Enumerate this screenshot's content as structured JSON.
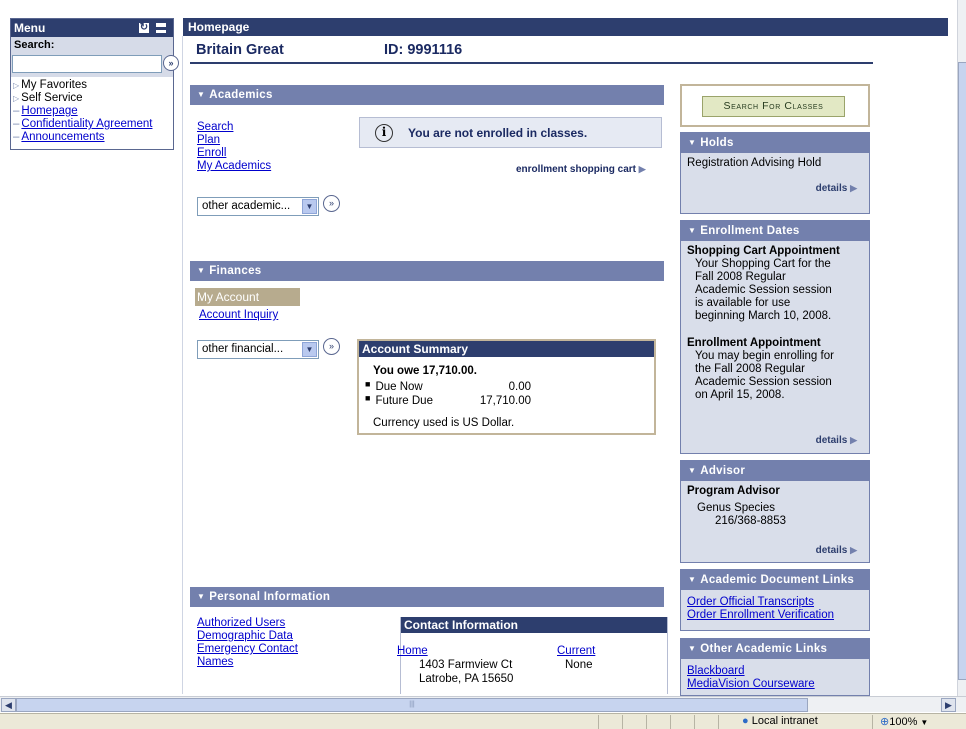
{
  "menu": {
    "title": "Menu",
    "search_label": "Search:",
    "search_value": "",
    "items": [
      {
        "label": "My Favorites"
      },
      {
        "label": "Self Service"
      },
      {
        "label": "Homepage"
      },
      {
        "label": "Confidentiality Agreement"
      },
      {
        "label": "Announcements"
      }
    ]
  },
  "page": {
    "title": "Homepage",
    "student_name": "Britain Great",
    "student_id": "ID: 9991116"
  },
  "academics": {
    "header": "Academics",
    "links": [
      "Search",
      "Plan",
      "Enroll",
      "My Academics"
    ],
    "notice": "You are not enrolled in classes.",
    "cart_link": "enrollment shopping cart",
    "dropdown_value": "other academic..."
  },
  "finances": {
    "header": "Finances",
    "my_account": "My Account",
    "account_inquiry": "Account Inquiry",
    "dropdown_value": "other financial...",
    "summary": {
      "title": "Account Summary",
      "owe": "You owe 17,710.00.",
      "due_now_label": "Due Now",
      "due_now_value": "0.00",
      "future_due_label": "Future Due",
      "future_due_value": "17,710.00",
      "currency": "Currency used is US Dollar."
    }
  },
  "personal": {
    "header": "Personal Information",
    "links": [
      "Authorized Users",
      "Demographic Data",
      "Emergency Contact",
      "Names"
    ],
    "contact": {
      "title": "Contact Information",
      "home_label": "Home",
      "address1": "1403 Farmview Ct",
      "address2": "Latrobe, PA 15650",
      "current_label": "Current",
      "current_value": "None"
    }
  },
  "right": {
    "search_classes": "Search For Classes",
    "holds": {
      "header": "Holds",
      "item": "Registration Advising Hold",
      "details": "details"
    },
    "enrollment_dates": {
      "header": "Enrollment Dates",
      "cart_title": "Shopping Cart Appointment",
      "cart_lines": [
        "Your Shopping Cart for the",
        "Fall 2008 Regular",
        "Academic Session session",
        "is available for use",
        "beginning March 10, 2008."
      ],
      "enroll_title": "Enrollment Appointment",
      "enroll_lines": [
        "You may begin enrolling for",
        "the Fall 2008 Regular",
        "Academic Session session",
        "on April 15, 2008."
      ],
      "details": "details"
    },
    "advisor": {
      "header": "Advisor",
      "title": "Program Advisor",
      "name": "Genus Species",
      "phone": "216/368-8853",
      "details": "details"
    },
    "doc_links": {
      "header": "Academic Document Links",
      "links": [
        "Order Official Transcripts",
        "Order Enrollment Verification"
      ]
    },
    "other_links": {
      "header": "Other Academic Links",
      "links": [
        "Blackboard",
        "MediaVision Courseware"
      ]
    }
  },
  "statusbar": {
    "zone": "Local intranet",
    "zoom": "100%"
  }
}
